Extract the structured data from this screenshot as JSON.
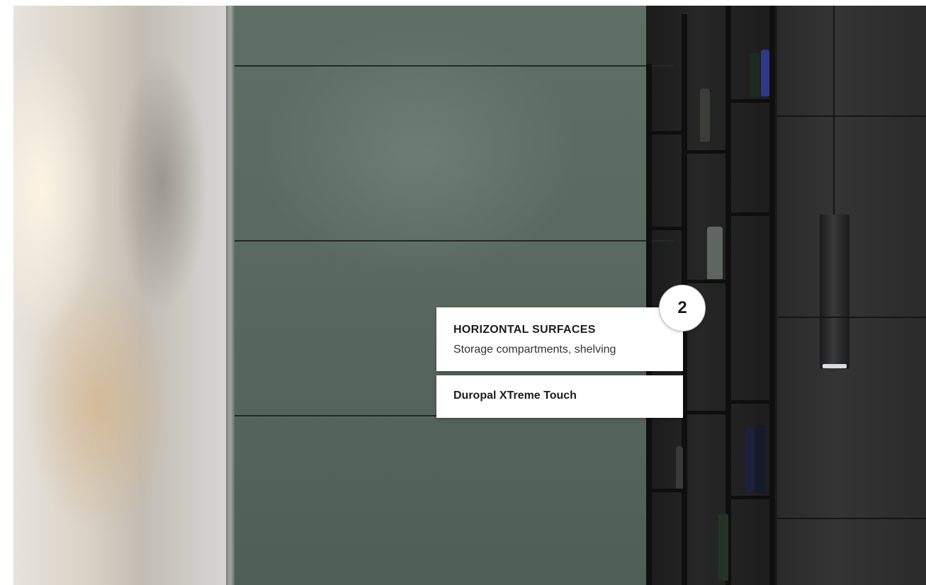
{
  "hotspot": {
    "number": "2",
    "title": "HORIZONTAL SURFACES",
    "subtitle": "Storage compartments, shelving",
    "product_prefix": "Duropal ",
    "product_mark": "X",
    "product_suffix": "Treme Touch"
  },
  "colors": {
    "wall": "#5a6a62",
    "shelving": "#1b1b1c",
    "cabinet": "#2f2f30",
    "card": "#ffffff"
  }
}
